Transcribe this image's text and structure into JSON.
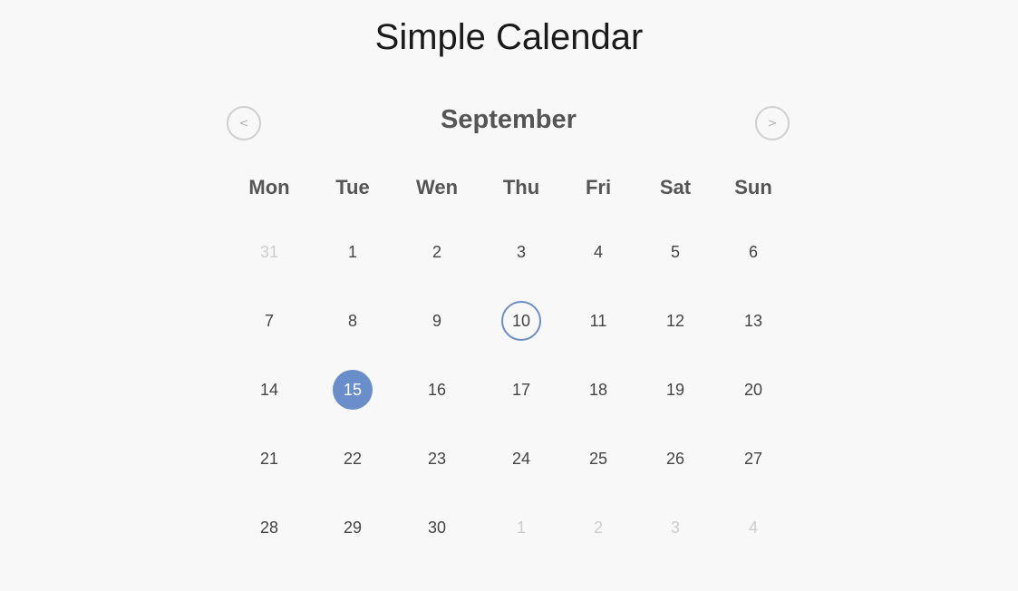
{
  "page": {
    "title": "Simple Calendar"
  },
  "calendar": {
    "month": "September",
    "prev_label": "<",
    "next_label": ">",
    "weekdays": [
      "Mon",
      "Tue",
      "Wen",
      "Thu",
      "Fri",
      "Sat",
      "Sun"
    ],
    "weeks": [
      [
        {
          "d": "31",
          "muted": true
        },
        {
          "d": "1"
        },
        {
          "d": "2"
        },
        {
          "d": "3"
        },
        {
          "d": "4"
        },
        {
          "d": "5"
        },
        {
          "d": "6"
        }
      ],
      [
        {
          "d": "7"
        },
        {
          "d": "8"
        },
        {
          "d": "9"
        },
        {
          "d": "10",
          "today": true
        },
        {
          "d": "11"
        },
        {
          "d": "12"
        },
        {
          "d": "13"
        }
      ],
      [
        {
          "d": "14"
        },
        {
          "d": "15",
          "selected": true
        },
        {
          "d": "16"
        },
        {
          "d": "17"
        },
        {
          "d": "18"
        },
        {
          "d": "19"
        },
        {
          "d": "20"
        }
      ],
      [
        {
          "d": "21"
        },
        {
          "d": "22"
        },
        {
          "d": "23"
        },
        {
          "d": "24"
        },
        {
          "d": "25"
        },
        {
          "d": "26"
        },
        {
          "d": "27"
        }
      ],
      [
        {
          "d": "28"
        },
        {
          "d": "29"
        },
        {
          "d": "30"
        },
        {
          "d": "1",
          "muted": true
        },
        {
          "d": "2",
          "muted": true
        },
        {
          "d": "3",
          "muted": true
        },
        {
          "d": "4",
          "muted": true
        }
      ]
    ]
  },
  "colors": {
    "background": "#f8f8f8",
    "accent": "#6a8ec9",
    "muted": "#cdcdcd",
    "text": "#444444"
  }
}
